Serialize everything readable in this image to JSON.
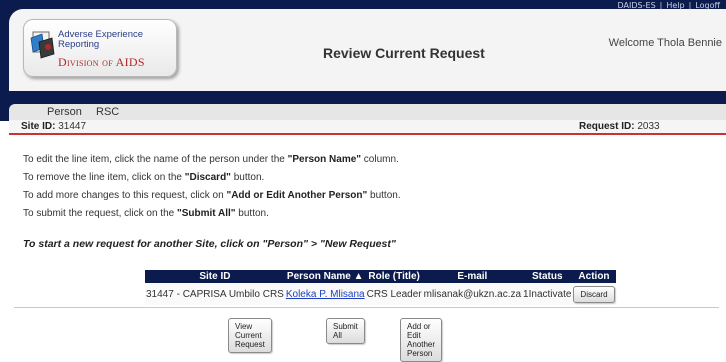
{
  "header": {
    "toplinks": [
      "DAIDS-ES",
      "|",
      "Help",
      "|",
      "Logoff"
    ],
    "logo": {
      "line1": "Adverse Experience",
      "line2": "Reporting",
      "line3": "Division of AIDS"
    },
    "page_title": "Review Current Request",
    "welcome": "Welcome Thola Bennie"
  },
  "nav": {
    "tabs": [
      "Person",
      "RSC"
    ]
  },
  "site_bar": {
    "site_id_label": "Site ID:",
    "site_id_value": "31447",
    "request_id_label": "Request ID:",
    "request_id_value": "2033"
  },
  "instructions": [
    {
      "pre": "To edit the line item, click the name of the person under the ",
      "bold": "\"Person Name\"",
      "post": " column."
    },
    {
      "pre": "To remove the line item, click on the ",
      "bold": "\"Discard\"",
      "post": " button."
    },
    {
      "pre": "To add more changes to this request, click on ",
      "bold": "\"Add or Edit Another Person\"",
      "post": " button."
    },
    {
      "pre": "To submit the request, click on the ",
      "bold": "\"Submit All\"",
      "post": " button."
    }
  ],
  "start_line": "To start a new request for another Site, click on \"Person\" > \"New Request\"",
  "table": {
    "headers": [
      "Site ID",
      "Person Name ▲",
      "Role (Title)",
      "E-mail",
      "Status",
      "Action"
    ],
    "rows": [
      {
        "site_id": "31447 - CAPRISA Umbilo CRS",
        "person_name": "Koleka P. Mlisana",
        "role": "CRS Leader",
        "email": "mlisanak@ukzn.ac.za",
        "status": "1Inactivate",
        "action": "Discard"
      }
    ]
  },
  "buttons": {
    "view_current": "View Current Request",
    "submit_all": "Submit All",
    "add_edit": "Add or Edit Another Person"
  },
  "colors": {
    "header_bg": "#0c1b4d",
    "accent_red": "#c8352f",
    "link": "#1f3fbf"
  }
}
